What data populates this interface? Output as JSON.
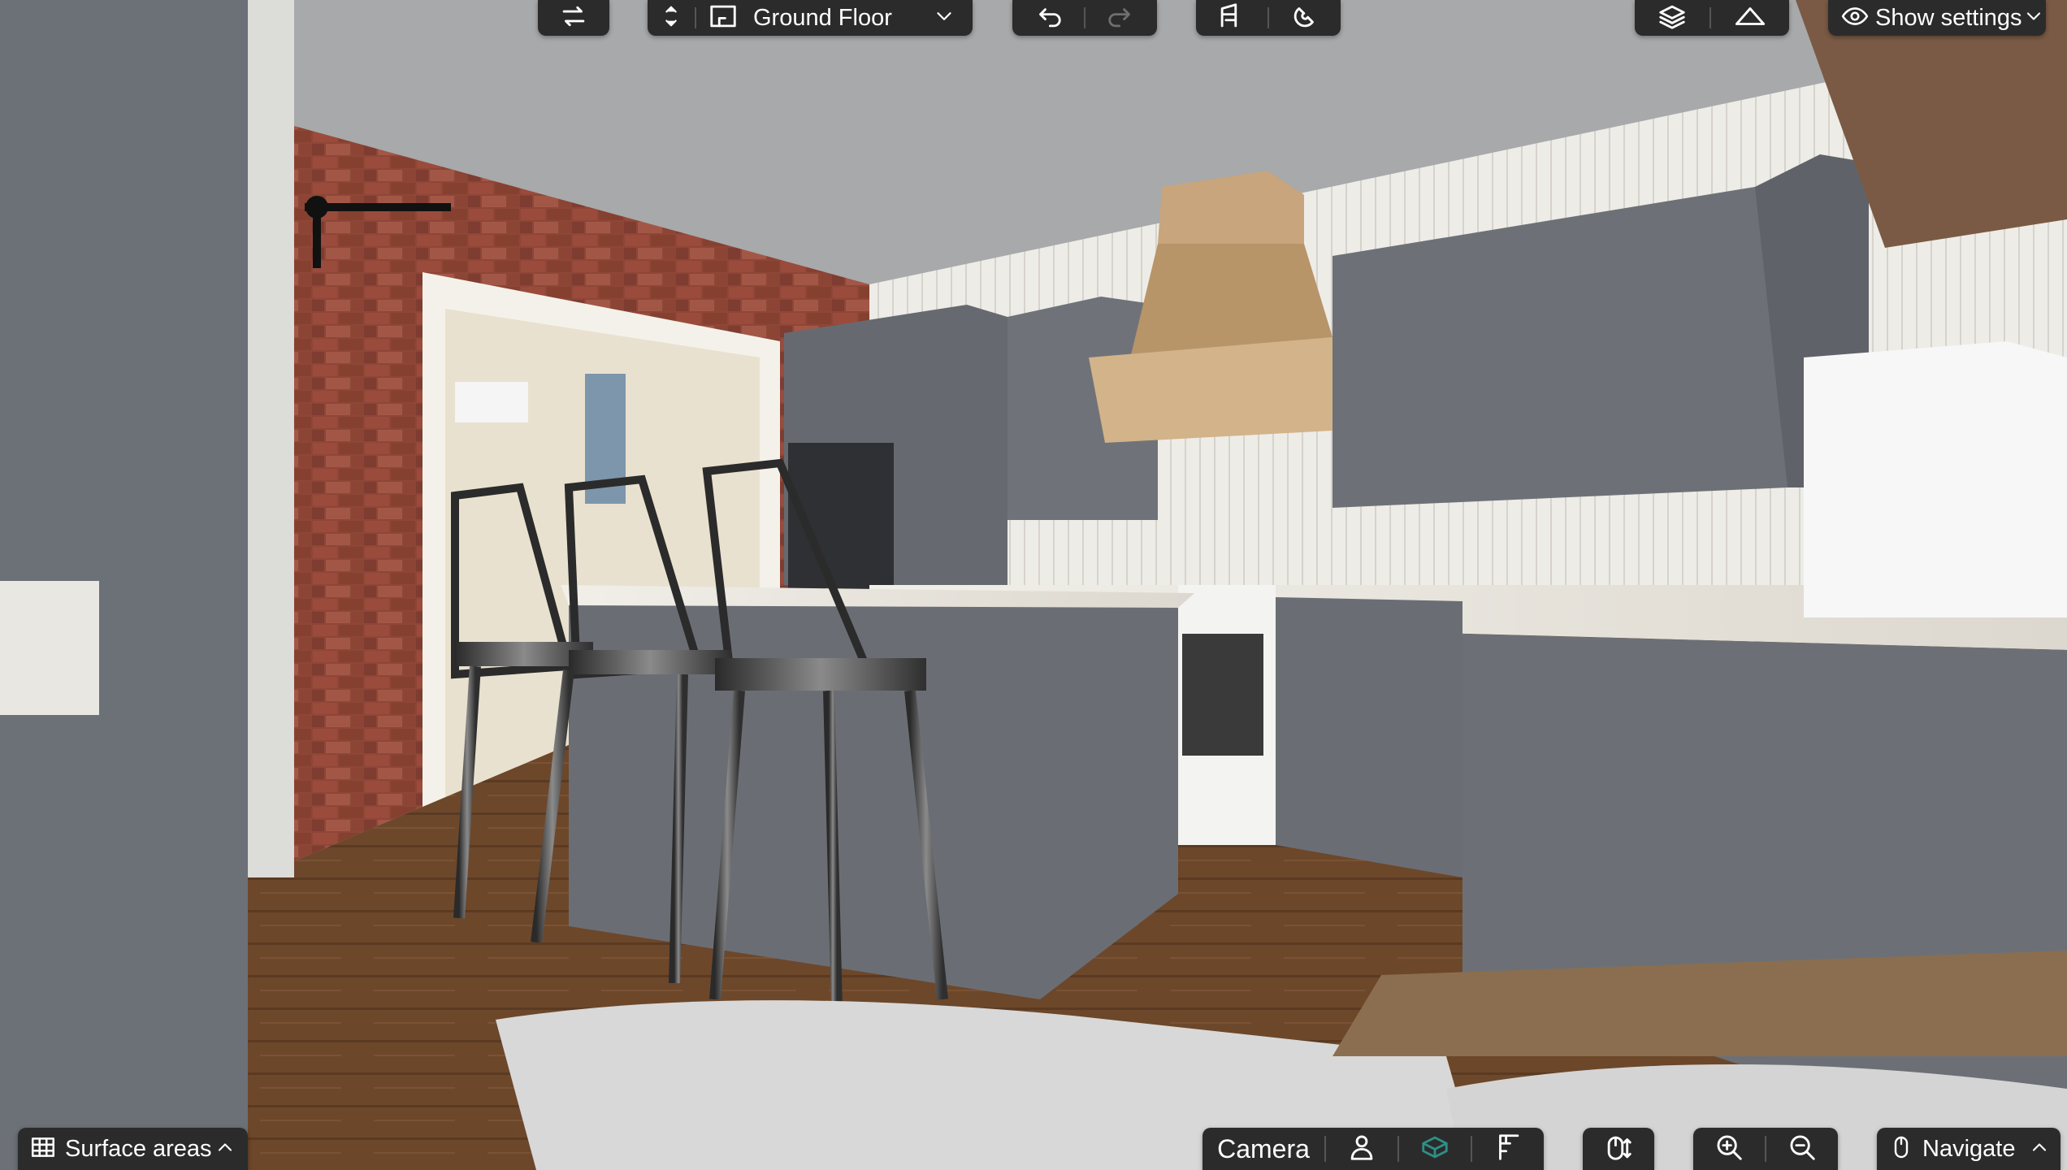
{
  "toolbar": {
    "floor_selector": {
      "label": "Ground Floor"
    },
    "view_settings": {
      "label": "Show settings"
    }
  },
  "bottom_bar": {
    "surface_areas": {
      "label": "Surface areas"
    },
    "camera": {
      "label": "Camera"
    },
    "navigate": {
      "label": "Navigate"
    }
  },
  "icons": {
    "swap": "swap-icon",
    "level_up_down": "level-arrows-icon",
    "floor_plan": "floor-plan-icon",
    "undo": "undo-icon",
    "redo": "redo-icon",
    "paint": "paint-icon",
    "magnet": "magnet-icon",
    "layers": "layers-icon",
    "roof": "roof-icon",
    "eye": "eye-icon",
    "grid": "grid-icon",
    "person": "person-icon",
    "cube": "cube-icon",
    "plan_view": "plan-view-icon",
    "mouse": "mouse-icon",
    "zoom_in": "zoom-in-icon",
    "zoom_out": "zoom-out-icon"
  },
  "colors": {
    "toolbar_bg": "#2b2b2b",
    "cabinet_gray": "#6b6f74",
    "wall_gray": "#a7a9ab",
    "floor_wood": "#6e4a2c",
    "brick_red": "#8a3f33",
    "hood_wood": "#c8a57c",
    "accent_teal": "#2e8f86"
  }
}
